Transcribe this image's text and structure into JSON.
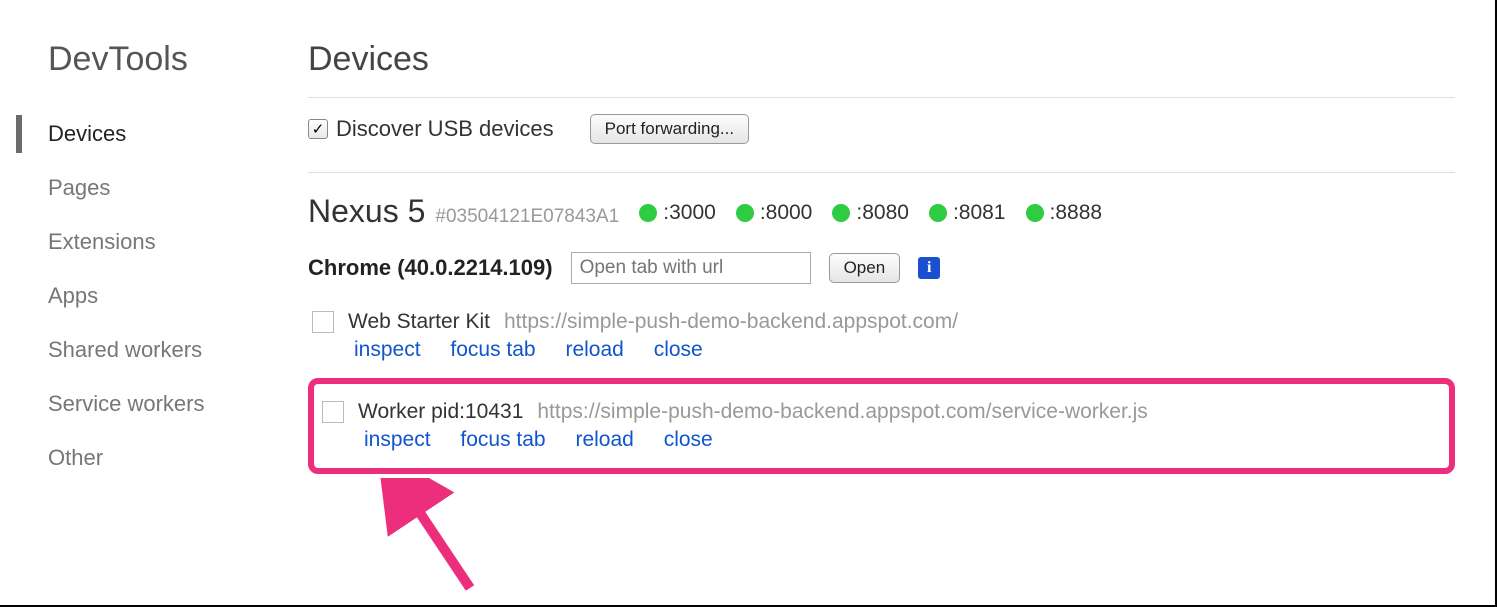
{
  "sidebar": {
    "title": "DevTools",
    "items": [
      "Devices",
      "Pages",
      "Extensions",
      "Apps",
      "Shared workers",
      "Service workers",
      "Other"
    ],
    "activeIndex": 0
  },
  "main": {
    "title": "Devices",
    "discover": {
      "label": "Discover USB devices",
      "checked": true
    },
    "portForwardBtn": "Port forwarding...",
    "device": {
      "name": "Nexus 5",
      "id": "#03504121E07843A1",
      "ports": [
        ":3000",
        ":8000",
        ":8080",
        ":8081",
        ":8888"
      ]
    },
    "browser": {
      "label": "Chrome (40.0.2214.109)",
      "placeholder": "Open tab with url",
      "openBtn": "Open"
    },
    "tabs": [
      {
        "title": "Web Starter Kit",
        "url": "https://simple-push-demo-backend.appspot.com/",
        "actions": [
          "inspect",
          "focus tab",
          "reload",
          "close"
        ],
        "highlighted": false
      },
      {
        "title": "Worker pid:10431",
        "url": "https://simple-push-demo-backend.appspot.com/service-worker.js",
        "actions": [
          "inspect",
          "focus tab",
          "reload",
          "close"
        ],
        "highlighted": true
      }
    ]
  },
  "colors": {
    "highlight": "#ed2e7c",
    "link": "#1155cc",
    "portDot": "#2ecc40"
  }
}
